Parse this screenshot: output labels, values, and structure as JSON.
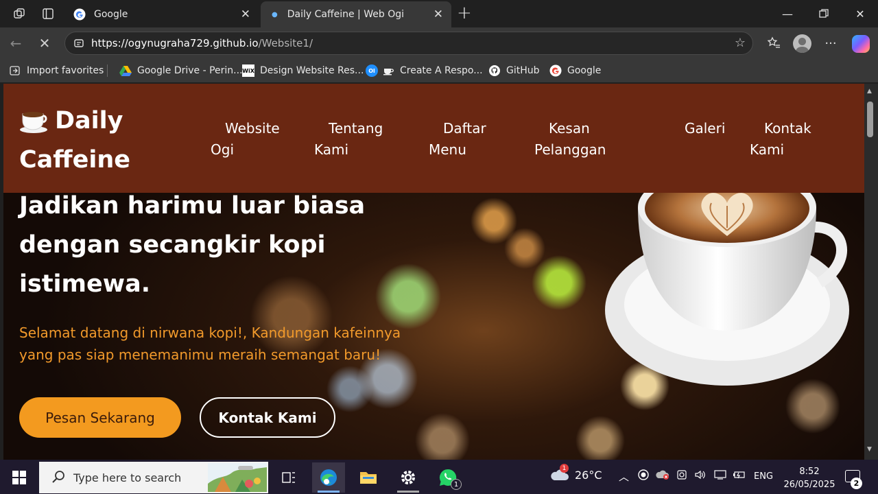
{
  "browser": {
    "tabs": [
      {
        "title": "Google",
        "active": false
      },
      {
        "title": "Daily Caffeine | Web Ogi",
        "active": true
      }
    ],
    "url_host": "https://ogynugraha729.github.io",
    "url_path": "/Website1/",
    "favorites": [
      {
        "label": "Import favorites",
        "icon": "import-icon"
      },
      {
        "label": "Google Drive - Perin...",
        "icon": "google-drive-icon"
      },
      {
        "label": "Design Website Res...",
        "icon": "wix-icon"
      },
      {
        "label": "Create A Respo...",
        "icon": "coffee-cup-icon"
      },
      {
        "label": "GitHub",
        "icon": "github-icon"
      },
      {
        "label": "Google",
        "icon": "google-icon"
      }
    ],
    "favorite_badge": "Ol",
    "wix_text": "WiX"
  },
  "site": {
    "brand_line1": "Daily",
    "brand_line2": "Caffeine",
    "nav": [
      {
        "label": "Website Ogi"
      },
      {
        "label": "Tentang Kami"
      },
      {
        "label": "Daftar Menu"
      },
      {
        "label": "Kesan Pelanggan"
      },
      {
        "label": "Galeri"
      },
      {
        "label": "Kontak Kami"
      }
    ],
    "hero_title": "Jadikan harimu luar biasa dengan secangkir kopi istimewa.",
    "hero_subtitle": "Selamat datang di nirwana kopi!, Kandungan kafeinnya yang pas siap menemanimu meraih semangat baru!",
    "btn_order": "Pesan Sekarang",
    "btn_contact": "Kontak Kami",
    "colors": {
      "nav_bg": "#6a2712",
      "accent": "#f39a1f",
      "subtitle": "#f29a2b"
    }
  },
  "taskbar": {
    "search_placeholder": "Type here to search",
    "temperature": "26°C",
    "weather_alert": "1",
    "language": "ENG",
    "time": "8:52",
    "date": "26/05/2025",
    "whatsapp_badge": "1",
    "notification_count": "2"
  }
}
